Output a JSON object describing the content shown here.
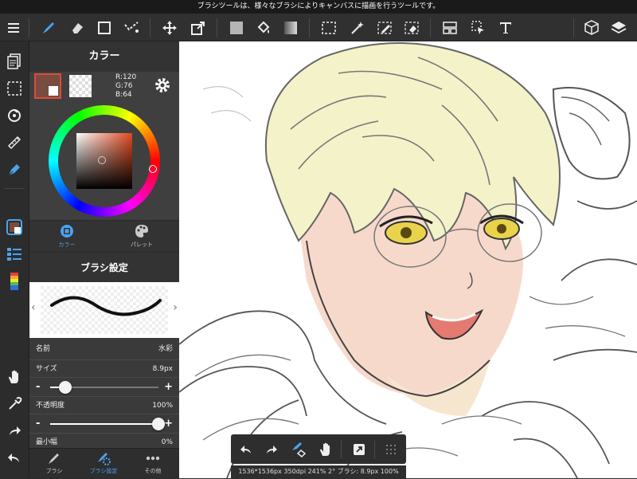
{
  "tooltip": "ブラシツールは、様々なブラシによりキャンバスに描画を行うツールです。",
  "toolbar": {
    "menu_icon": "menu-icon",
    "tools": [
      "brush-icon",
      "eraser-icon",
      "rectangle-icon",
      "dot-brush-icon",
      "move-icon",
      "transform-icon",
      "fill-color-icon",
      "bucket-icon",
      "gradient-icon",
      "select-rect-icon",
      "magic-wand-icon",
      "select-pen-icon",
      "select-eraser-icon",
      "panel-layout-icon",
      "select-layer-icon",
      "text-icon",
      "3d-icon",
      "layers-icon"
    ],
    "active_tool": "brush-icon",
    "accent": "#4aa3f0"
  },
  "color_panel": {
    "title": "カラー",
    "current_color": "#784c40",
    "rgb_lines": [
      "R:120",
      "G:76",
      "B:64"
    ],
    "tabs": [
      {
        "label": "カラー",
        "icon": "color-circle-icon",
        "active": true
      },
      {
        "label": "パレット",
        "icon": "palette-icon",
        "active": false
      }
    ]
  },
  "brush_panel": {
    "title": "ブラシ設定",
    "name_label": "名前",
    "name_value": "水彩",
    "size_label": "サイズ",
    "size_value": "8.9px",
    "size_level": 0.14,
    "opacity_label": "不透明度",
    "opacity_value": "100%",
    "opacity_level": 1.0,
    "minwidth_label": "最小幅",
    "minwidth_value": "0%",
    "minus": "-",
    "plus": "+"
  },
  "bottom_tabs": [
    {
      "label": "ブラシ",
      "active": false
    },
    {
      "label": "ブラシ設定",
      "active": true
    },
    {
      "label": "その他",
      "active": false
    }
  ],
  "status": "1536*1536px 350dpi 241% 2° ブラシ: 8.9px 100%"
}
